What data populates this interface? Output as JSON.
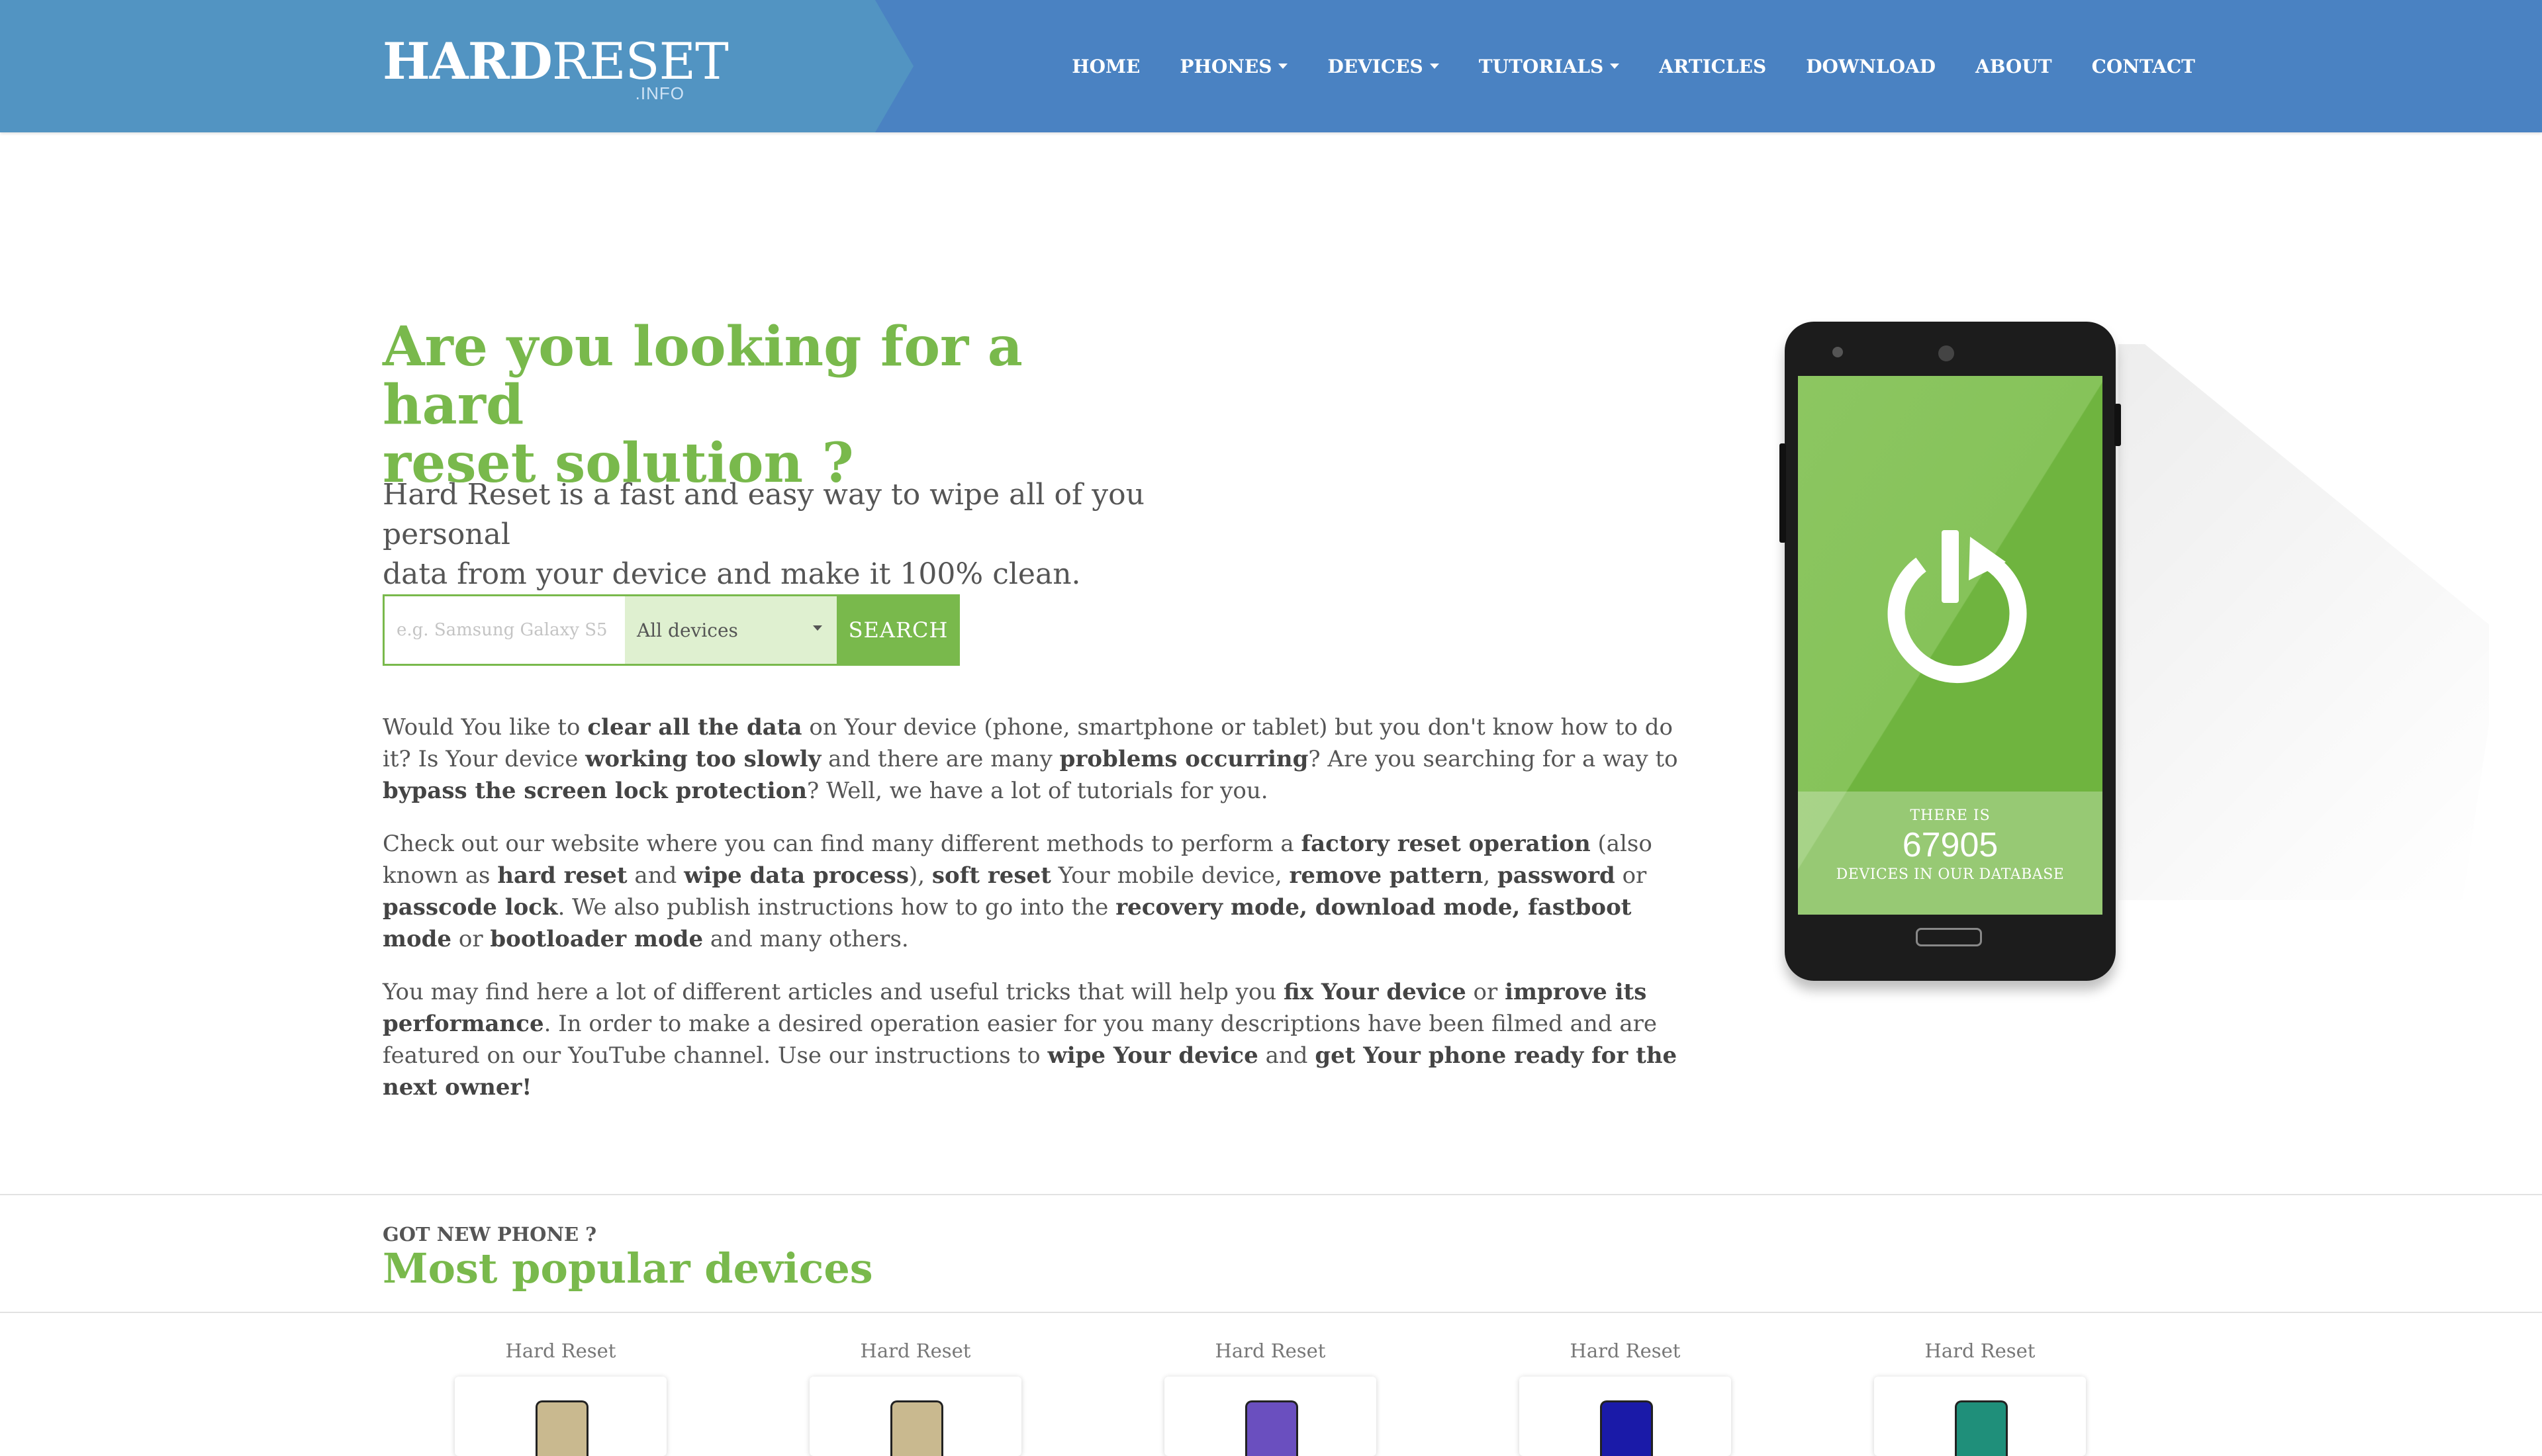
{
  "header": {
    "logo_bold": "HARD",
    "logo_light": "RESET",
    "logo_sub": ".INFO",
    "nav": [
      {
        "label": "HOME",
        "dropdown": false
      },
      {
        "label": "PHONES",
        "dropdown": true
      },
      {
        "label": "DEVICES",
        "dropdown": true
      },
      {
        "label": "TUTORIALS",
        "dropdown": true
      },
      {
        "label": "ARTICLES",
        "dropdown": false
      },
      {
        "label": "DOWNLOAD",
        "dropdown": false
      },
      {
        "label": "ABOUT",
        "dropdown": false
      },
      {
        "label": "CONTACT",
        "dropdown": false
      }
    ]
  },
  "hero": {
    "title_line1": "Are you looking for a hard",
    "title_line2": "reset solution ?",
    "subtitle_line1": "Hard Reset is a fast and easy way to wipe all of you personal",
    "subtitle_line2": "data from your device and make it 100% clean."
  },
  "search": {
    "placeholder": "e.g. Samsung Galaxy S5",
    "value": "",
    "select_value": "All devices",
    "button": "SEARCH"
  },
  "content": {
    "p1": {
      "a": "Would You like to ",
      "b1": "clear all the data",
      "c": " on Your device (phone, smartphone or tablet) but you don't know how to do it? Is Your device ",
      "b2": "working too slowly",
      "d": " and there are many ",
      "b3": "problems occurring",
      "e": "? Are you searching for a way to ",
      "b4": "bypass the screen lock protection",
      "f": "? Well, we have a lot of tutorials for you."
    },
    "p2": {
      "a": "Check out our website where you can find many different methods to perform a ",
      "b1": "factory reset operation",
      "c": " (also known as ",
      "b2": "hard reset",
      "d": " and ",
      "b3": "wipe data process",
      "e": "), ",
      "b4": "soft reset",
      "f": " Your mobile device, ",
      "b5": "remove pattern",
      "g": ", ",
      "b6": "password",
      "h": " or ",
      "b7": "passcode lock",
      "i": ". We also publish instructions how to go into the ",
      "b8": "recovery mode, download mode, fastboot mode",
      "j": " or ",
      "b9": "bootloader mode",
      "k": " and many others."
    },
    "p3": {
      "a": "You may find here a lot of different articles and useful tricks that will help you ",
      "b1": "fix Your device",
      "c": " or ",
      "b2": "improve its performance",
      "d": ". In order to make a desired operation easier for you many descriptions have been filmed and are featured on our YouTube channel. Use our instructions to ",
      "b3": "wipe Your device",
      "e": " and ",
      "b4": "get Your phone ready for the next owner!"
    }
  },
  "phone_counter": {
    "top": "THERE IS",
    "number": "67905",
    "bottom": "DEVICES IN OUR DATABASE"
  },
  "popular": {
    "kicker": "GOT NEW PHONE ?",
    "title": "Most popular devices",
    "devices": [
      {
        "label": "Hard Reset",
        "color": "#c9b98f"
      },
      {
        "label": "Hard Reset",
        "color": "#c9b98f"
      },
      {
        "label": "Hard Reset",
        "color": "#6a4fbf"
      },
      {
        "label": "Hard Reset",
        "color": "#1a1aa8"
      },
      {
        "label": "Hard Reset",
        "color": "#1f8f7a"
      }
    ]
  },
  "colors": {
    "nav_bg": "#4a82c2",
    "brand_plate": "#5294c2",
    "accent_green": "#79b94c"
  }
}
